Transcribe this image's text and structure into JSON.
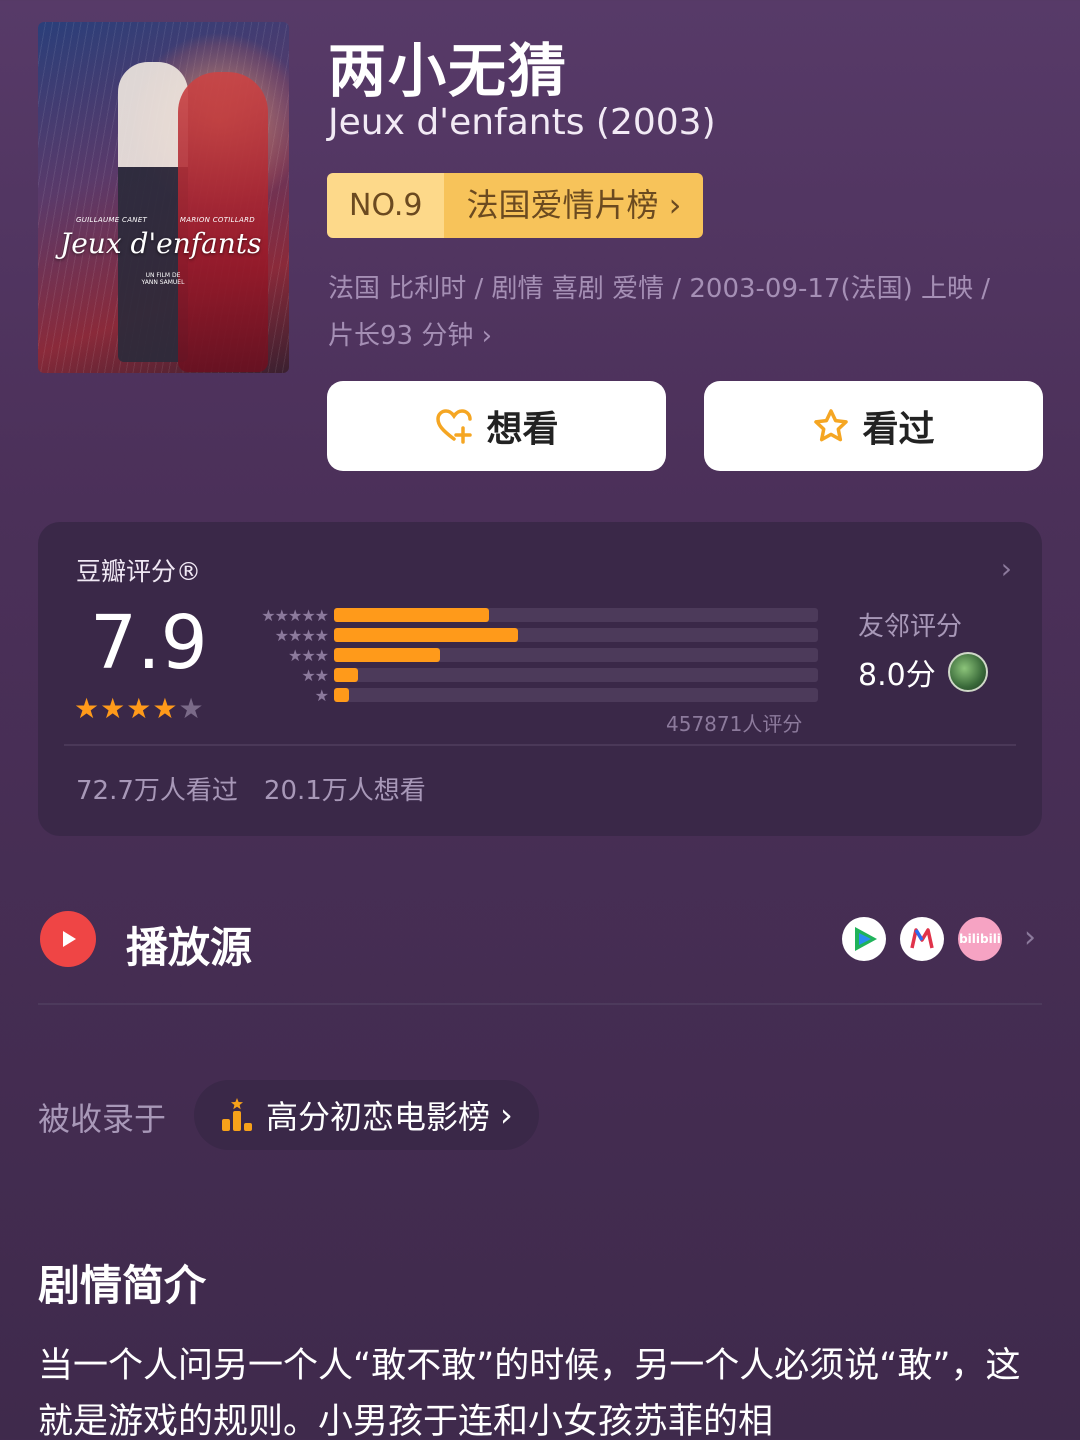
{
  "movie": {
    "title_cn": "两小无猜",
    "title_en": "Jeux d'enfants (2003)",
    "rank_no": "NO.9",
    "rank_list": "法国爱情片榜",
    "info_line1": "法国 比利时 / 剧情 喜剧 爱情 / 2003-09-17(法国) 上映 /",
    "info_line2": "片长93 分钟",
    "poster": {
      "title": "Jeux d'enfants",
      "actor_left": "GUILLAUME CANET",
      "actor_right": "MARION COTILLARD",
      "director": "UN FILM DE YANN SAMUEL"
    }
  },
  "actions": {
    "want_label": "想看",
    "seen_label": "看过"
  },
  "rating": {
    "label": "豆瓣评分®",
    "score": "7.9",
    "stars_filled": 4,
    "star_rows": [
      "★★★★★",
      "★★★★",
      "★★★",
      "★★",
      "★"
    ],
    "distribution": [
      0.32,
      0.38,
      0.22,
      0.05,
      0.03
    ],
    "votes": "457871人评分",
    "friend_label": "友邻评分",
    "friend_score": "8.0分",
    "seen_count": "72.7万人看过",
    "want_count": "20.1万人想看"
  },
  "sources": {
    "title": "播放源",
    "bili_text": "bilibili"
  },
  "collection": {
    "label": "被收录于",
    "chip_text": "高分初恋电影榜"
  },
  "synopsis": {
    "title": "剧情简介",
    "text": "当一个人问另一个人“敢不敢”的时候，另一个人必须说“敢”，这就是游戏的规则。小男孩于连和小女孩苏菲的相"
  },
  "colors": {
    "accent_orange": "#ff9a1a",
    "play_red": "#ef4545",
    "rank_gold": "#f7c35a"
  }
}
